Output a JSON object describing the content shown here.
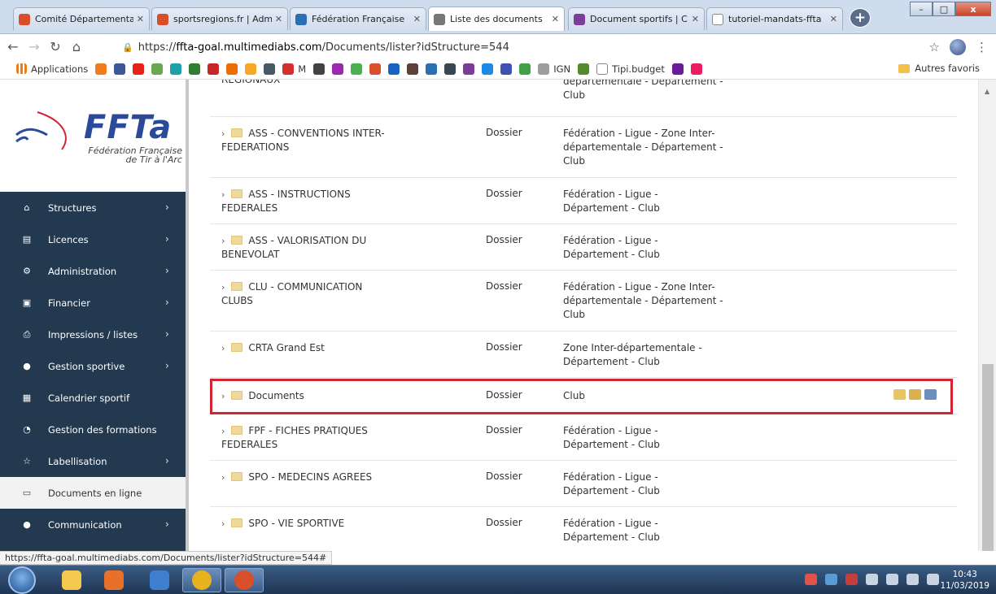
{
  "browser": {
    "tabs": [
      {
        "title": "Comité Départementa",
        "favicon_color": "#d94f2a"
      },
      {
        "title": "sportsregions.fr | Adm",
        "favicon_color": "#d94f2a"
      },
      {
        "title": "Fédération Française",
        "favicon_color": "#2a6fb0"
      },
      {
        "title": "Liste des documents",
        "favicon_color": "#777777",
        "active": true
      },
      {
        "title": "Document sportifs | C",
        "favicon_color": "#7b3d9a"
      },
      {
        "title": "tutoriel-mandats-ffta",
        "favicon_color": "#ffffff"
      }
    ],
    "new_tab_label": "+",
    "window_controls": {
      "minimize": "–",
      "maximize": "□",
      "close": "x"
    },
    "url": {
      "scheme": "https://",
      "host": "ffta-goal.multimediabs.com",
      "path": "/Documents/lister?idStructure=544"
    },
    "bookmarks": [
      {
        "label": "Applications",
        "color": "#e87d1e"
      },
      {
        "label": "",
        "color": "#f07c1c"
      },
      {
        "label": "",
        "color": "#3b5998"
      },
      {
        "label": "",
        "color": "#e62117"
      },
      {
        "label": "",
        "color": "#6aa84f"
      },
      {
        "label": "",
        "color": "#1ba1a8"
      },
      {
        "label": "",
        "color": "#2e7d32"
      },
      {
        "label": "",
        "color": "#c62828"
      },
      {
        "label": "",
        "color": "#ef6c00"
      },
      {
        "label": "",
        "color": "#f9a825"
      },
      {
        "label": "",
        "color": "#455a64"
      },
      {
        "label": "M",
        "color": "#d32f2f"
      },
      {
        "label": "",
        "color": "#424242"
      },
      {
        "label": "",
        "color": "#9c27b0"
      },
      {
        "label": "",
        "color": "#4caf50"
      },
      {
        "label": "",
        "color": "#d94f2a"
      },
      {
        "label": "",
        "color": "#1565c0"
      },
      {
        "label": "",
        "color": "#5d4037"
      },
      {
        "label": "",
        "color": "#2a6fb0"
      },
      {
        "label": "",
        "color": "#37474f"
      },
      {
        "label": "",
        "color": "#7b3d9a"
      },
      {
        "label": "",
        "color": "#1e88e5"
      },
      {
        "label": "",
        "color": "#3f51b5"
      },
      {
        "label": "",
        "color": "#43a047"
      },
      {
        "label": "IGN",
        "color": "#9e9e9e"
      },
      {
        "label": "",
        "color": "#558b2f"
      },
      {
        "label": "Tipi.budget",
        "color": "#ffffff"
      },
      {
        "label": "",
        "color": "#6a1b9a"
      },
      {
        "label": "",
        "color": "#e91e63"
      }
    ],
    "other_bookmarks": "Autres favoris",
    "status_url": "https://ffta-goal.multimediabs.com/Documents/lister?idStructure=544#"
  },
  "logo": {
    "text": "FFTa",
    "subtitle_line1": "Fédération Française",
    "subtitle_line2": "de Tir à l'Arc"
  },
  "sidebar": {
    "items": [
      {
        "label": "Structures",
        "icon": "home-icon",
        "glyph": "⌂",
        "chevron": true
      },
      {
        "label": "Licences",
        "icon": "id-card-icon",
        "glyph": "▤",
        "chevron": true
      },
      {
        "label": "Administration",
        "icon": "gears-icon",
        "glyph": "⚙",
        "chevron": true
      },
      {
        "label": "Financier",
        "icon": "money-icon",
        "glyph": "▣",
        "chevron": true
      },
      {
        "label": "Impressions / listes",
        "icon": "print-icon",
        "glyph": "⎙",
        "chevron": true
      },
      {
        "label": "Gestion sportive",
        "icon": "target-icon",
        "glyph": "●",
        "chevron": true
      },
      {
        "label": "Calendrier sportif",
        "icon": "calendar-icon",
        "glyph": "▦",
        "chevron": false
      },
      {
        "label": "Gestion des formations",
        "icon": "dashboard-icon",
        "glyph": "◔",
        "chevron": false
      },
      {
        "label": "Labellisation",
        "icon": "star-icon",
        "glyph": "☆",
        "chevron": true
      },
      {
        "label": "Documents en ligne",
        "icon": "folder-open-icon",
        "glyph": "▭",
        "chevron": false,
        "active": true
      },
      {
        "label": "Communication",
        "icon": "comments-icon",
        "glyph": "●",
        "chevron": true
      }
    ],
    "chevron_glyph": "›"
  },
  "table": {
    "rows": [
      {
        "name": "REGIONAUX",
        "partial_top": true,
        "type": "",
        "levels": "départementale - Département - Club",
        "partial_levels": true
      },
      {
        "name": "ASS - CONVENTIONS INTER-FEDERATIONS",
        "type": "Dossier",
        "levels": "Fédération - Ligue - Zone Inter-départementale - Département - Club"
      },
      {
        "name": "ASS - INSTRUCTIONS FEDERALES",
        "type": "Dossier",
        "levels": "Fédération - Ligue - Département - Club"
      },
      {
        "name": "ASS - VALORISATION DU BENEVOLAT",
        "type": "Dossier",
        "levels": "Fédération - Ligue - Département - Club"
      },
      {
        "name": "CLU - COMMUNICATION CLUBS",
        "type": "Dossier",
        "levels": "Fédération - Ligue - Zone Inter-départementale - Département - Club"
      },
      {
        "name": "CRTA Grand Est",
        "type": "Dossier",
        "levels": "Zone Inter-départementale - Département - Club"
      },
      {
        "name": "Documents",
        "type": "Dossier",
        "levels": "Club",
        "highlighted": true
      },
      {
        "name": "FPF - FICHES PRATIQUES FEDERALES",
        "type": "Dossier",
        "levels": "Fédération - Ligue - Département - Club"
      },
      {
        "name": "SPO - MEDECINS AGREES",
        "type": "Dossier",
        "levels": "Fédération - Ligue - Département - Club"
      },
      {
        "name": "SPO - VIE SPORTIVE",
        "type": "Dossier",
        "levels": "Fédération - Ligue - Département - Club"
      }
    ],
    "chevron_glyph": "›",
    "highlight_color": "#d32431"
  },
  "taskbar": {
    "apps": [
      {
        "name": "explorer",
        "color": "#f2c94c"
      },
      {
        "name": "media-player",
        "color": "#e8702a"
      },
      {
        "name": "outlook",
        "color": "#3d7ecf"
      },
      {
        "name": "chrome",
        "color": "#e8b21e",
        "active": true
      },
      {
        "name": "chrome-profile",
        "color": "#d94f2a",
        "active": true
      }
    ],
    "time": "10:43",
    "date": "11/03/2019"
  }
}
